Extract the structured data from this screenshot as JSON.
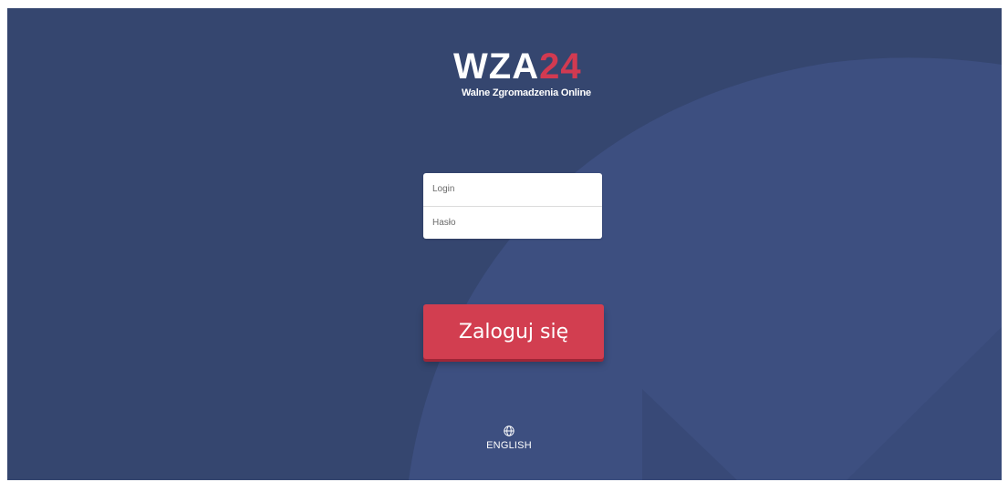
{
  "logo": {
    "main": "WZA",
    "accent": "24",
    "subtitle": "Walne Zgromadzenia Online"
  },
  "form": {
    "login_placeholder": "Login",
    "password_placeholder": "Hasło",
    "submit_label": "Zaloguj się"
  },
  "language": {
    "icon": "globe-icon",
    "label": "ENGLISH"
  },
  "colors": {
    "background": "#35466f",
    "background_shape": "#3d4f80",
    "accent": "#d23e50",
    "text_light": "#ffffff"
  }
}
